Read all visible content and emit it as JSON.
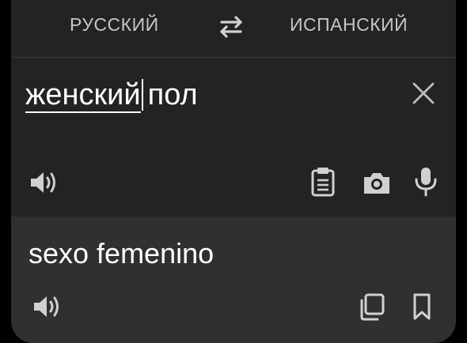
{
  "languages": {
    "source": "РУССКИЙ",
    "target": "ИСПАНСКИЙ"
  },
  "input": {
    "word_underlined": "женский",
    "word_rest": "пол"
  },
  "output": {
    "text": "sexo femenino"
  },
  "icons": {
    "swap": "swap-arrows-icon",
    "clear": "close-icon",
    "speak_source": "speaker-icon",
    "paste": "clipboard-icon",
    "camera": "camera-icon",
    "mic": "microphone-icon",
    "speak_target": "speaker-icon",
    "copy": "copy-icon",
    "bookmark": "bookmark-icon"
  },
  "colors": {
    "background": "#232325",
    "output_background": "#303033",
    "text": "#ffffff",
    "icon": "#d0d0d2"
  }
}
